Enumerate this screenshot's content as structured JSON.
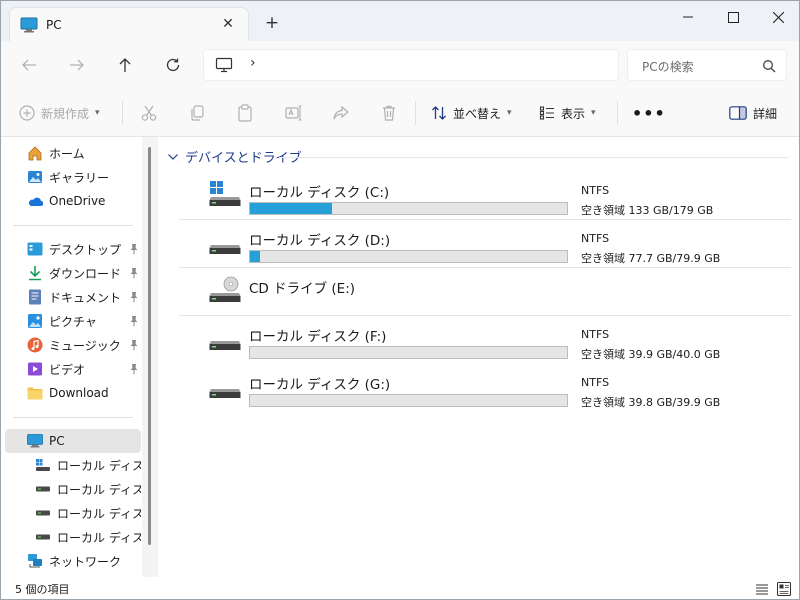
{
  "window": {
    "tab_title": "PC",
    "new_tab": "+",
    "close_tab": "✕"
  },
  "address": {
    "chevron": "›",
    "search_placeholder": "PCの検索"
  },
  "toolbar": {
    "new_label": "新規作成",
    "sort_label": "並べ替え",
    "view_label": "表示",
    "more_label": "•••",
    "details_label": "詳細"
  },
  "sidebar": {
    "quick": [
      {
        "label": "ホーム",
        "icon": "home-icon"
      },
      {
        "label": "ギャラリー",
        "icon": "gallery-icon"
      },
      {
        "label": "OneDrive",
        "icon": "onedrive-icon"
      }
    ],
    "pinned": [
      {
        "label": "デスクトップ",
        "icon": "desktop-icon",
        "pinned": true
      },
      {
        "label": "ダウンロード",
        "icon": "download-icon",
        "pinned": true
      },
      {
        "label": "ドキュメント",
        "icon": "document-icon",
        "pinned": true
      },
      {
        "label": "ピクチャ",
        "icon": "pictures-icon",
        "pinned": true
      },
      {
        "label": "ミュージック",
        "icon": "music-icon",
        "pinned": true
      },
      {
        "label": "ビデオ",
        "icon": "video-icon",
        "pinned": true
      },
      {
        "label": "Download",
        "icon": "folder-icon",
        "pinned": false
      }
    ],
    "pc": {
      "label": "PC",
      "icon": "pc-icon"
    },
    "pc_children": [
      {
        "label": "ローカル ディスク (C:)",
        "icon": "windows-drive-icon"
      },
      {
        "label": "ローカル ディスク (D:)",
        "icon": "drive-icon"
      },
      {
        "label": "ローカル ディスク (F:)",
        "icon": "drive-icon"
      },
      {
        "label": "ローカル ディスク (G:)",
        "icon": "drive-icon"
      }
    ],
    "network": {
      "label": "ネットワーク",
      "icon": "network-icon"
    }
  },
  "main": {
    "group_title": "デバイスとドライブ",
    "drives": [
      {
        "name": "ローカル ディスク (C:)",
        "fs": "NTFS",
        "free": "空き領域 133 GB/179 GB",
        "used_fraction": 0.26,
        "icon": "windows-drive-icon"
      },
      {
        "name": "ローカル ディスク (D:)",
        "fs": "NTFS",
        "free": "空き領域 77.7 GB/79.9 GB",
        "used_fraction": 0.03,
        "icon": "drive-icon"
      },
      {
        "name": "CD ドライブ (E:)",
        "fs": "",
        "free": "",
        "used_fraction": null,
        "icon": "cd-drive-icon"
      },
      {
        "name": "ローカル ディスク (F:)",
        "fs": "NTFS",
        "free": "空き領域 39.9 GB/40.0 GB",
        "used_fraction": 0.0,
        "icon": "drive-icon"
      },
      {
        "name": "ローカル ディスク (G:)",
        "fs": "NTFS",
        "free": "空き領域 39.8 GB/39.9 GB",
        "used_fraction": 0.0,
        "icon": "drive-icon"
      }
    ]
  },
  "status": {
    "item_count": "5 個の項目"
  },
  "colors": {
    "accent": "#26a0da",
    "group_header": "#1f3c88"
  }
}
